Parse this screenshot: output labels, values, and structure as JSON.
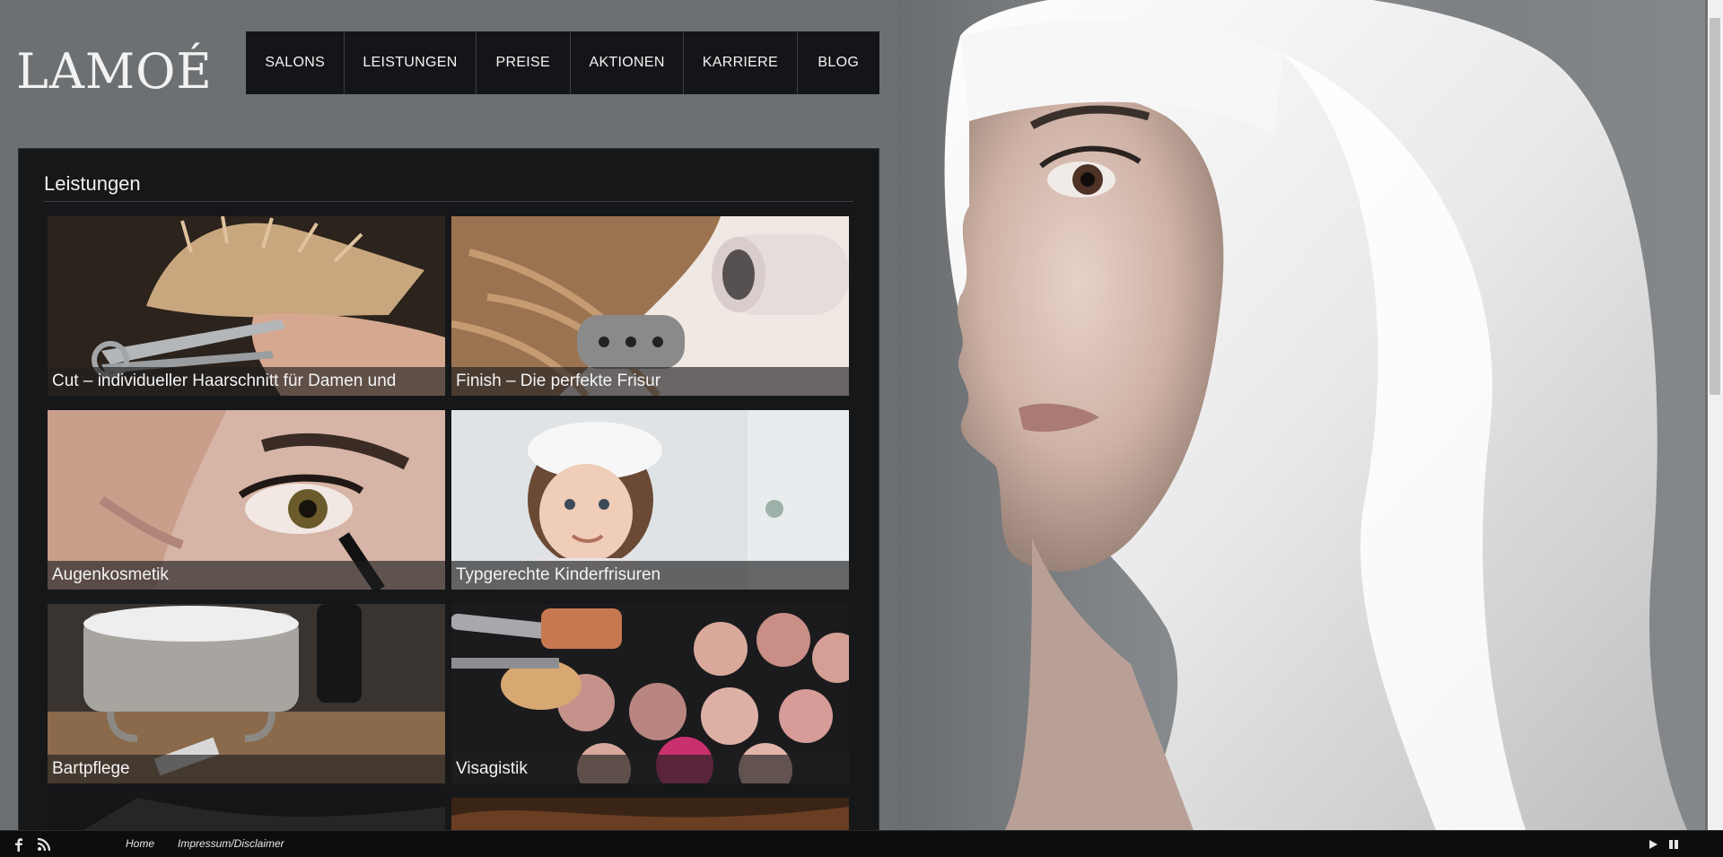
{
  "brand": {
    "logo_text": "LAMOÉ"
  },
  "nav": {
    "items": [
      {
        "label": "SALONS"
      },
      {
        "label": "LEISTUNGEN"
      },
      {
        "label": "PREISE"
      },
      {
        "label": "AKTIONEN"
      },
      {
        "label": "KARRIERE"
      },
      {
        "label": "BLOG"
      }
    ]
  },
  "main": {
    "title": "Leistungen",
    "tiles": [
      {
        "caption": "Cut – individueller Haarschnitt für Damen und"
      },
      {
        "caption": "Finish – Die perfekte Frisur"
      },
      {
        "caption": "Augenkosmetik"
      },
      {
        "caption": "Typgerechte Kinderfrisuren"
      },
      {
        "caption": "Bartpflege"
      },
      {
        "caption": "Visagistik"
      }
    ]
  },
  "footer": {
    "links": [
      {
        "label": "Home"
      },
      {
        "label": "Impressum/Disclaimer"
      }
    ],
    "icons": [
      "facebook-icon",
      "rss-icon",
      "play-icon",
      "pause-icon"
    ]
  },
  "colors": {
    "page_bg": "#6d7073",
    "panel_bg": "#161719",
    "nav_bg": "#141518",
    "footer_bg": "#0d0d0e"
  }
}
